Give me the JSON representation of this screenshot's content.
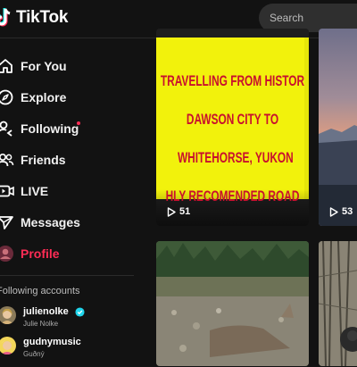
{
  "header": {
    "logo_text": "TikTok",
    "search_placeholder": "Search"
  },
  "nav": [
    {
      "label": "For You",
      "icon": "home-icon"
    },
    {
      "label": "Explore",
      "icon": "compass-icon"
    },
    {
      "label": "Following",
      "icon": "following-icon",
      "has_dot": true
    },
    {
      "label": "Friends",
      "icon": "friends-icon"
    },
    {
      "label": "LIVE",
      "icon": "live-icon"
    },
    {
      "label": "Messages",
      "icon": "messages-icon"
    },
    {
      "label": "Profile",
      "icon": "avatar",
      "active": true
    }
  ],
  "following_section": {
    "title": "Following accounts",
    "accounts": [
      {
        "username": "julienolke",
        "display": "Julie Nolke",
        "verified": true
      },
      {
        "username": "gudnymusic",
        "display": "Guðný",
        "verified": false
      }
    ]
  },
  "videos": [
    {
      "caption_lines": [
        "TRAVELLING FROM HISTOR",
        "DAWSON CITY TO",
        "WHITEHORSE, YUKON",
        "HLY RECOMENDED ROAD"
      ],
      "views": "51"
    },
    {
      "views": "53"
    },
    {
      "views": ""
    },
    {
      "views": ""
    }
  ],
  "colors": {
    "accent": "#fe2c55",
    "background": "#121212",
    "thumbnail_yellow": "#f2f20c",
    "caption_red": "#c8102e"
  }
}
